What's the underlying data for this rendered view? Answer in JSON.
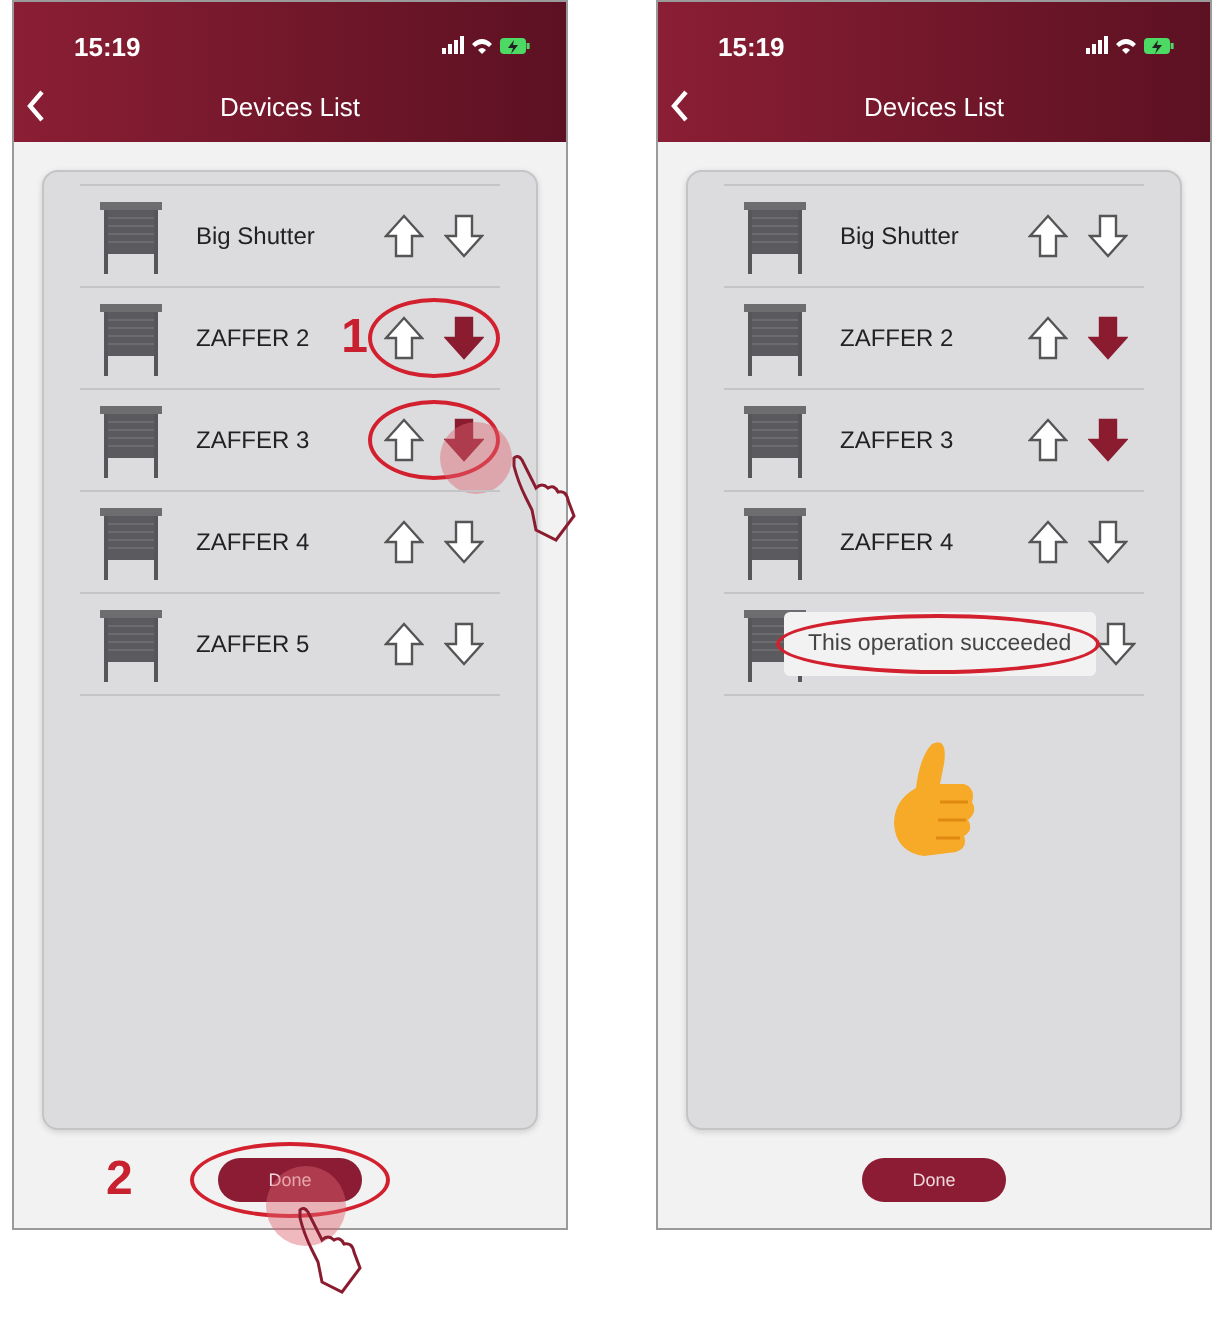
{
  "screens": [
    {
      "status_bar": {
        "time": "15:19"
      },
      "title": "Devices List",
      "devices": [
        {
          "name": "Big Shutter",
          "down_on": false,
          "circled": false,
          "tapped": false
        },
        {
          "name": "ZAFFER 2",
          "down_on": true,
          "circled": true,
          "tapped": false,
          "step": "1"
        },
        {
          "name": "ZAFFER 3",
          "down_on": true,
          "circled": true,
          "tapped": true
        },
        {
          "name": "ZAFFER 4",
          "down_on": false,
          "circled": false,
          "tapped": false
        },
        {
          "name": "ZAFFER 5",
          "down_on": false,
          "circled": false,
          "tapped": false
        }
      ],
      "thumbs_up": false,
      "done": {
        "label": "Done",
        "circled": true,
        "tapped": true,
        "step": "2"
      }
    },
    {
      "status_bar": {
        "time": "15:19"
      },
      "title": "Devices List",
      "devices": [
        {
          "name": "Big Shutter",
          "down_on": false,
          "circled": false,
          "tapped": false
        },
        {
          "name": "ZAFFER 2",
          "down_on": true,
          "circled": false,
          "tapped": false
        },
        {
          "name": "ZAFFER 3",
          "down_on": true,
          "circled": false,
          "tapped": false
        },
        {
          "name": "ZAFFER 4",
          "down_on": false,
          "circled": false,
          "tapped": false
        },
        {
          "down_on": false,
          "circled": false,
          "tapped": false,
          "toast": {
            "text": "This operation succeeded",
            "circled": true
          }
        }
      ],
      "thumbs_up": true,
      "done": {
        "label": "Done",
        "circled": false,
        "tapped": false
      }
    }
  ]
}
